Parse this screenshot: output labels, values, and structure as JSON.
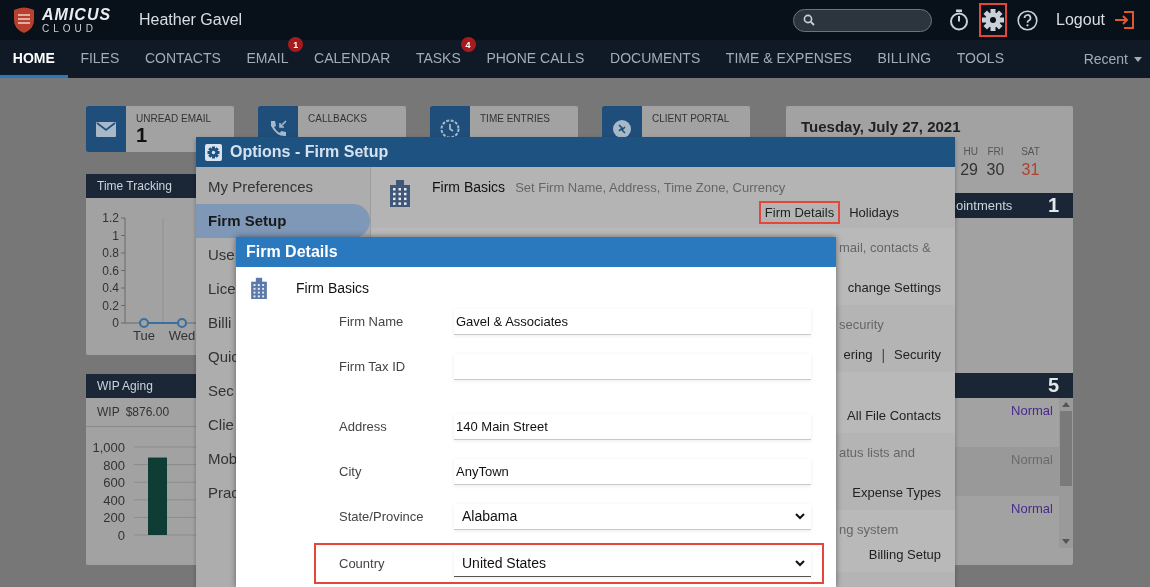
{
  "header": {
    "logo": {
      "title": "AMICUS",
      "subtitle": "CLOUD"
    },
    "user": "Heather Gavel",
    "tools": [
      {
        "kind": "timer",
        "highlighted": false
      },
      {
        "kind": "settings",
        "highlighted": true
      },
      {
        "kind": "help",
        "highlighted": false
      }
    ],
    "logout": "Logout"
  },
  "nav": {
    "items": [
      {
        "label": "HOME",
        "selected": true
      },
      {
        "label": "FILES",
        "selected": false
      },
      {
        "label": "CONTACTS",
        "selected": false
      },
      {
        "label": "EMAIL",
        "selected": false,
        "badge": "1"
      },
      {
        "label": "CALENDAR",
        "selected": false
      },
      {
        "label": "TASKS",
        "selected": false,
        "badge": "4"
      },
      {
        "label": "PHONE CALLS",
        "selected": false
      },
      {
        "label": "DOCUMENTS",
        "selected": false
      },
      {
        "label": "TIME & EXPENSES",
        "selected": false
      },
      {
        "label": "BILLING",
        "selected": false
      },
      {
        "label": "TOOLS",
        "selected": false
      }
    ],
    "recent": "Recent"
  },
  "dashboard": {
    "stats": [
      {
        "kind": "email",
        "label": "UNREAD EMAIL",
        "value": "1"
      },
      {
        "kind": "callback",
        "label": "CALLBACKS"
      },
      {
        "kind": "clock",
        "label": "TIME ENTRIES"
      },
      {
        "kind": "portal",
        "label": "CLIENT PORTAL"
      }
    ],
    "time_tracking": {
      "title": "Time Tracking",
      "chart_data": {
        "type": "line",
        "marker": "o",
        "grid": true,
        "categories": [
          "Tue",
          "Wed"
        ],
        "values": [
          0,
          0
        ],
        "ylim": [
          0,
          1.2
        ],
        "yticks": [
          0,
          0.2,
          0.4,
          0.6,
          0.8,
          1,
          1.2
        ]
      }
    },
    "wip": {
      "title": "WIP Aging",
      "total_label": "WIP",
      "total": "$876.00",
      "chart_data": {
        "type": "bar",
        "grid": true,
        "values": [
          880
        ],
        "ylim": [
          0,
          1000
        ],
        "yticks": [
          {
            "value": 0,
            "label": "0"
          },
          {
            "value": 200,
            "label": "200"
          },
          {
            "value": 400,
            "label": "400"
          },
          {
            "value": 600,
            "label": "600"
          },
          {
            "value": 800,
            "label": "800"
          },
          {
            "value": 1000,
            "label": "1,000"
          }
        ]
      }
    },
    "calendar": {
      "date": "Tuesday, July 27, 2021",
      "days": [
        {
          "name": "HU",
          "date": "29",
          "weekend": false
        },
        {
          "name": "FRI",
          "date": "30",
          "weekend": false
        },
        {
          "name": "SAT",
          "date": "31",
          "weekend": true
        }
      ]
    },
    "appointments": {
      "title": "ointments",
      "count": "1"
    },
    "tasks": {
      "count": "5",
      "items": [
        {
          "priority": "Normal",
          "muted": false
        },
        {
          "priority": "Normal",
          "muted": true
        },
        {
          "priority": "Normal",
          "muted": false
        }
      ]
    }
  },
  "options": {
    "title": "Options - Firm Setup",
    "menu": [
      {
        "label": "My Preferences",
        "selected": false
      },
      {
        "label": "Firm Setup",
        "selected": true
      },
      {
        "label": "Use",
        "selected": false
      },
      {
        "label": "Lice",
        "selected": false
      },
      {
        "label": "Billi",
        "selected": false
      },
      {
        "label": "Quic",
        "selected": false
      },
      {
        "label": "Sec",
        "selected": false
      },
      {
        "label": "Clie",
        "selected": false
      },
      {
        "label": "Mob",
        "selected": false
      },
      {
        "label": "Prac",
        "selected": false
      }
    ],
    "sections": [
      {
        "kind": "full",
        "title": "Firm Basics",
        "description": "Set Firm Name, Address, Time Zone, Currency",
        "links": [
          {
            "label": "Firm Details",
            "highlighted": true
          },
          {
            "label": "Holidays",
            "highlighted": false
          }
        ]
      },
      {
        "kind": "partial",
        "description": "mail, contacts &",
        "links": [
          {
            "label": "change Settings",
            "highlighted": false
          }
        ]
      },
      {
        "kind": "partial",
        "description": "security",
        "separator": "|",
        "links": [
          {
            "label": "ering",
            "highlighted": false
          },
          {
            "label": "Security",
            "highlighted": false
          }
        ]
      },
      {
        "kind": "partial",
        "links": [
          {
            "label": "All File Contacts",
            "highlighted": false
          }
        ]
      },
      {
        "kind": "partial",
        "description": "atus lists and",
        "links": [
          {
            "label": "Expense Types",
            "highlighted": false
          }
        ]
      },
      {
        "kind": "partial",
        "description": "ng system",
        "links": [
          {
            "label": "Billing Setup",
            "highlighted": false
          }
        ]
      }
    ]
  },
  "firm_details": {
    "title": "Firm Details",
    "section": "Firm Basics",
    "fields": [
      {
        "kind": "text",
        "label": "Firm Name",
        "value": "Gavel & Associates",
        "highlighted": false
      },
      {
        "kind": "text",
        "label": "Firm Tax ID",
        "highlighted": false
      },
      {
        "kind": "text",
        "label": "Address",
        "value": "140 Main Street",
        "highlighted": false
      },
      {
        "kind": "text",
        "label": "City",
        "value": "AnyTown",
        "highlighted": false
      },
      {
        "kind": "select",
        "label": "State/Province",
        "value": "Alabama",
        "highlighted": false
      },
      {
        "kind": "select",
        "label": "Country",
        "value": "United States",
        "highlighted": true
      }
    ]
  }
}
